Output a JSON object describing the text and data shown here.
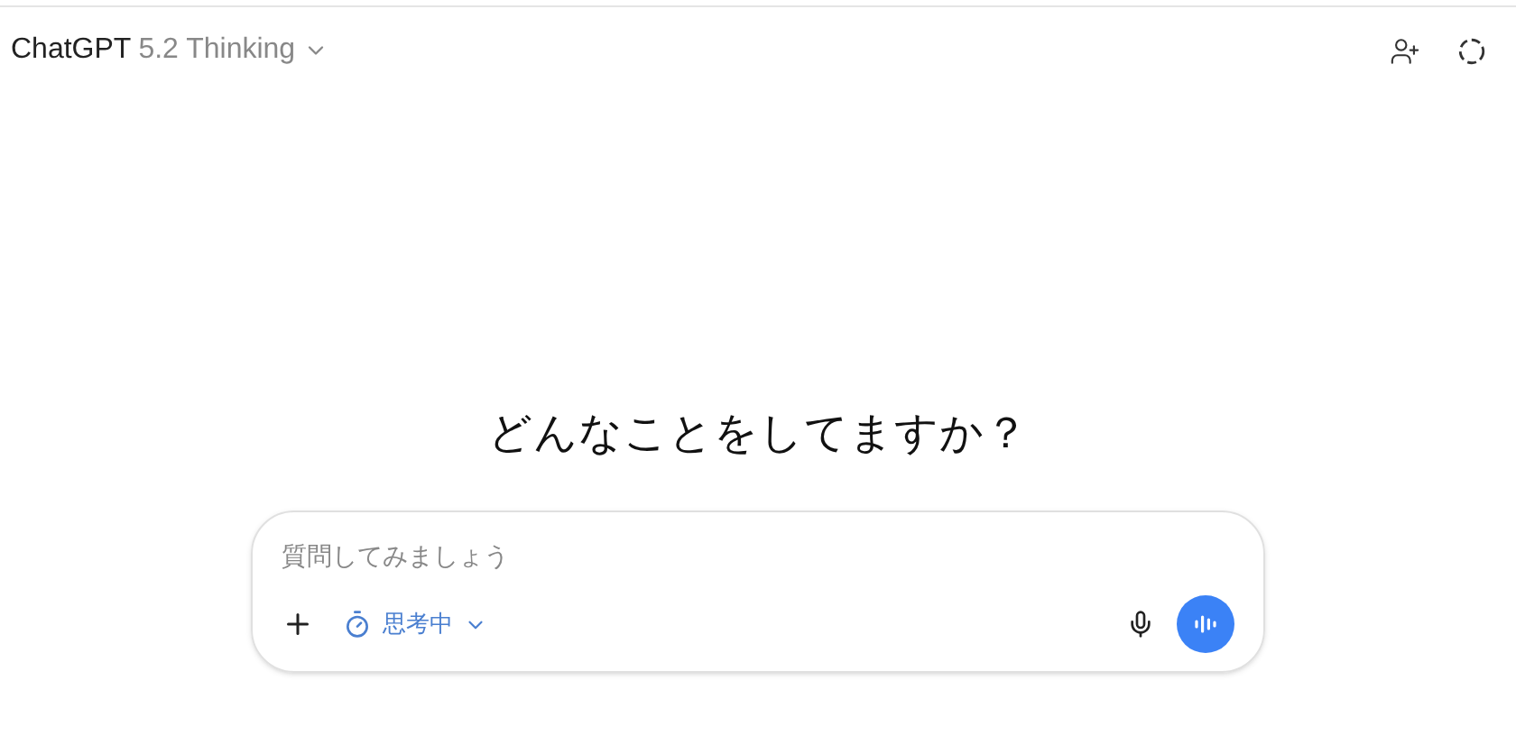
{
  "header": {
    "brand": "ChatGPT",
    "model": "5.2 Thinking"
  },
  "heading": "どんなことをしてますか？",
  "composer": {
    "placeholder": "質問してみましょう",
    "mode": "思考中"
  }
}
